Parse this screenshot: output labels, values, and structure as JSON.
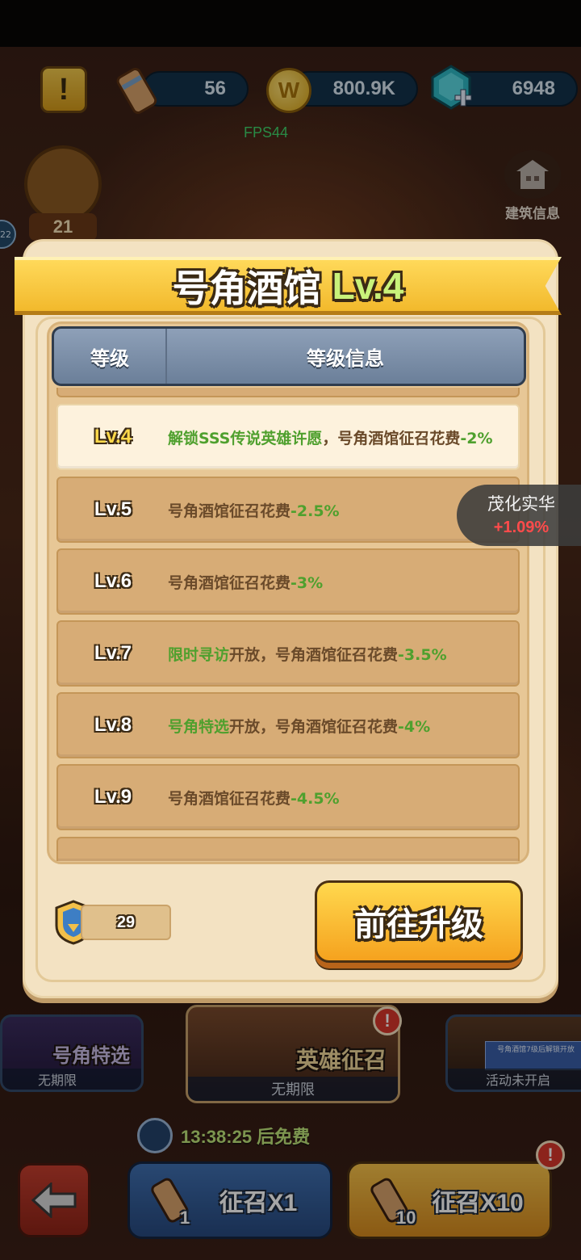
{
  "top_bar": {
    "scroll_count": "56",
    "gold_count": "800.9K",
    "gem_count": "6948",
    "fps": "FPS44",
    "horn_count": "21",
    "side_badge": "22",
    "building_info_label": "建筑信息"
  },
  "panel": {
    "title": "号角酒馆",
    "title_level": "Lv.4",
    "header_level": "等级",
    "header_info": "等级信息",
    "rows": [
      {
        "level": "Lv.4",
        "highlight": "解锁SSS传说英雄许愿",
        "text": "，号角酒馆征召花费",
        "value": "-2%",
        "current": true
      },
      {
        "level": "Lv.5",
        "highlight": "",
        "text": "号角酒馆征召花费",
        "value": "-2.5%"
      },
      {
        "level": "Lv.6",
        "highlight": "",
        "text": "号角酒馆征召花费",
        "value": "-3%"
      },
      {
        "level": "Lv.7",
        "highlight": "限时寻访",
        "text": "开放，号角酒馆征召花费",
        "value": "-3.5%"
      },
      {
        "level": "Lv.8",
        "highlight": "号角特选",
        "text": "开放，号角酒馆征召花费",
        "value": "-4%"
      },
      {
        "level": "Lv.9",
        "highlight": "",
        "text": "号角酒馆征召花费",
        "value": "-4.5%"
      }
    ],
    "token_count": "29",
    "upgrade_button": "前往升级"
  },
  "toast": {
    "title": "茂化实华",
    "change": "+1.09%"
  },
  "bottom": {
    "card_left_name": "号角特选",
    "card_left_foot": "无期限",
    "card_mid_name": "英雄征召",
    "card_mid_foot": "无期限",
    "card_right_note": "号角酒馆7级后解锁开放",
    "card_right_foot": "活动未开启",
    "timer": "13:38:25 后免费",
    "recruit_x1": "征召X1",
    "recruit_x10": "征召X10",
    "recruit_x1_badge": "1",
    "recruit_x10_badge": "10"
  },
  "colors": {
    "accent_green": "#4fa02e",
    "gold": "#f5b72a",
    "toast_red": "#ff4b4b"
  }
}
